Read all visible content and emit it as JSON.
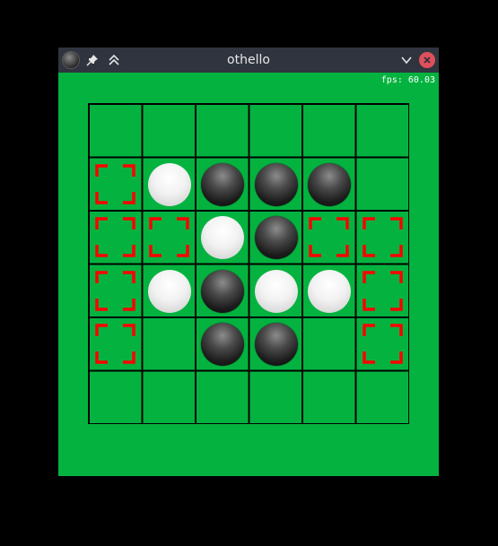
{
  "window": {
    "title": "othello",
    "fps_text": "fps: 60.03"
  },
  "colors": {
    "board_green": "#04b33f",
    "grid_line": "#000000",
    "marker_red": "#ff0000",
    "titlebar": "#2f343f",
    "close_button": "#e0505a"
  },
  "icons": {
    "app": "othello-piece-icon",
    "pin": "pin-icon",
    "keep_above": "double-chevron-up-icon",
    "minimize": "chevron-down-icon",
    "close": "close-icon"
  },
  "board": {
    "cols": 6,
    "rows": 6,
    "cells": [
      [
        "",
        "",
        "",
        "",
        "",
        ""
      ],
      [
        "move",
        "white",
        "black",
        "black",
        "black",
        ""
      ],
      [
        "move",
        "move",
        "white",
        "black",
        "move",
        "move"
      ],
      [
        "move",
        "white",
        "black",
        "white",
        "white",
        "move"
      ],
      [
        "move",
        "",
        "black",
        "black",
        "",
        "move"
      ],
      [
        "",
        "",
        "",
        "",
        "",
        ""
      ]
    ]
  }
}
